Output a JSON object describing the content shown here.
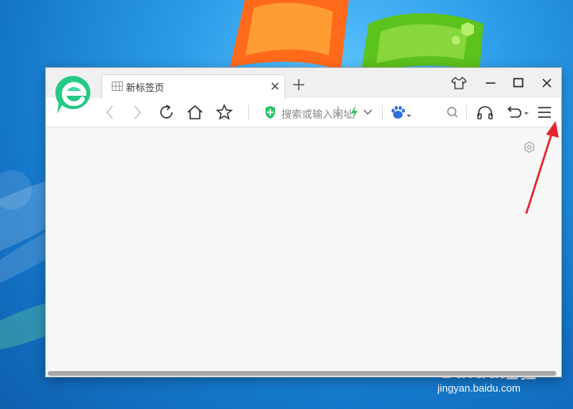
{
  "browser": {
    "tab": {
      "title": "新标签页"
    },
    "address_bar": {
      "placeholder": "搜索或输入网址"
    }
  },
  "watermark": {
    "brand": "Baidu经验",
    "url": "jingyan.baidu.com"
  },
  "icons": [
    "browser-logo",
    "tab-grid",
    "close",
    "plus",
    "shirt-skin",
    "minimize",
    "maximize",
    "close-window",
    "back",
    "forward",
    "refresh",
    "home",
    "star",
    "shield-plus",
    "lightning",
    "chevron-down",
    "baidu-paw",
    "search",
    "headphones",
    "undo",
    "menu",
    "settings-hexagon"
  ],
  "colors": {
    "accent": "#2bd18f",
    "annotation_arrow": "#e5242b",
    "lightning": "#2fbf5b",
    "baidu_blue": "#2f6fe0"
  }
}
